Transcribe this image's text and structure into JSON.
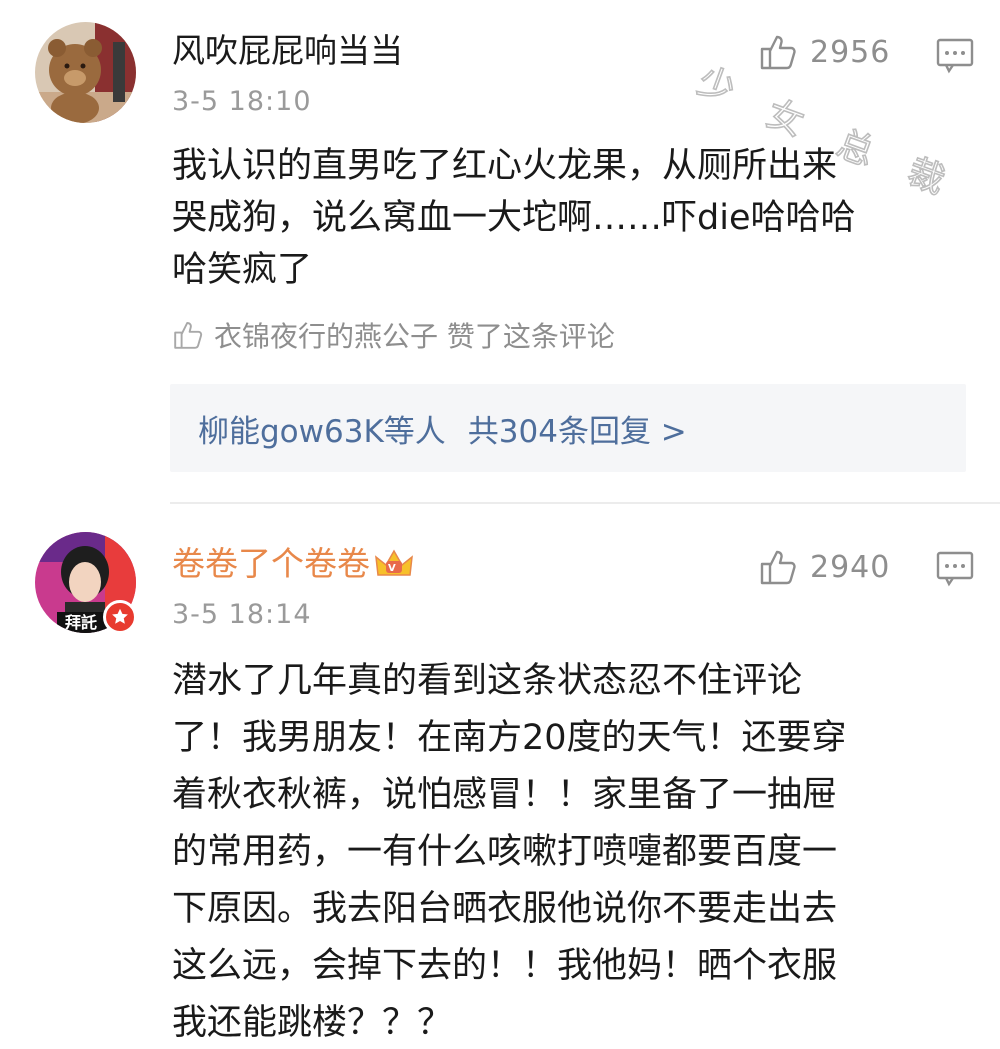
{
  "comments": [
    {
      "username": "风吹屁屁响当当",
      "time": "3-5 18:10",
      "likes": "2956",
      "lines": [
        "我认识的直男吃了红心火龙果，从厕所出来",
        "哭成狗，说么窝血一大坨啊……吓die哈哈哈",
        "哈笑疯了"
      ],
      "liked_by": "衣锦夜行的燕公子 赞了这条评论",
      "reply_users": "柳能gow63K等人",
      "reply_total": "共304条回复 >"
    },
    {
      "username": "卷卷了个卷卷",
      "time": "3-5 18:14",
      "likes": "2940",
      "lines": [
        "潜水了几年真的看到这条状态忍不住评论",
        "了！我男朋友！在南方20度的天气！还要穿",
        "着秋衣秋裤，说怕感冒！！家里备了一抽屉",
        "的常用药，一有什么咳嗽打喷嚏都要百度一",
        "下原因。我去阳台晒衣服他说你不要走出去",
        "这么远，会掉下去的！！我他妈！晒个衣服",
        "我还能跳楼？？？"
      ],
      "avatar_caption": "拜託"
    }
  ],
  "watermark": "少女总裁",
  "icons": {
    "like": "thumbs-up-icon",
    "comment": "comment-bubble-icon",
    "liked_by": "small-thumbs-up-icon",
    "badge": "verified-star-icon",
    "crown": "vip-crown-icon"
  },
  "colors": {
    "reply_link": "#4e6e9c",
    "vip_name": "#e8884a",
    "muted": "#8e8e8e",
    "reply_bg": "#f5f6f8"
  }
}
